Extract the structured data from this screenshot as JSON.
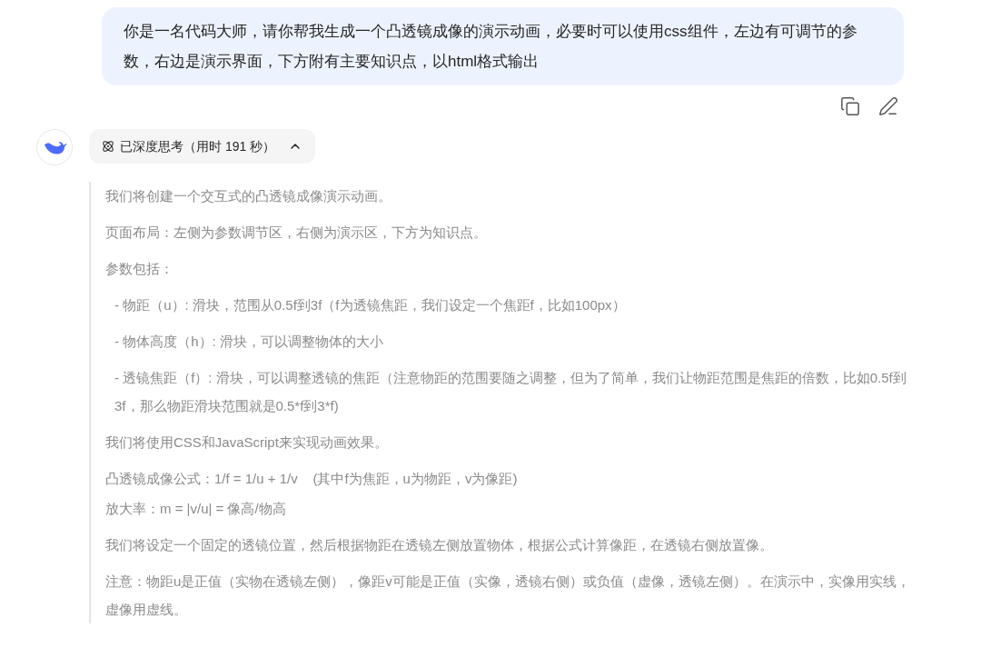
{
  "user_message": {
    "text": "你是一名代码大师，请你帮我生成一个凸透镜成像的演示动画，必要时可以使用css组件，左边有可调节的参数，右边是演示界面，下方附有主要知识点，以html格式输出"
  },
  "thinking": {
    "label": "已深度思考（用时 191 秒）",
    "expanded": true,
    "paragraphs": [
      {
        "kind": "plain",
        "text": "我们将创建一个交互式的凸透镜成像演示动画。"
      },
      {
        "kind": "plain",
        "text": "页面布局：左侧为参数调节区，右侧为演示区，下方为知识点。"
      },
      {
        "kind": "plain",
        "text": "参数包括："
      },
      {
        "kind": "item",
        "text": "- 物距（u）: 滑块，范围从0.5f到3f（f为透镜焦距，我们设定一个焦距f，比如100px）"
      },
      {
        "kind": "item",
        "text": "- 物体高度（h）: 滑块，可以调整物体的大小"
      },
      {
        "kind": "item",
        "text": "- 透镜焦距（f）: 滑块，可以调整透镜的焦距（注意物距的范围要随之调整，但为了简单，我们让物距范围是焦距的倍数，比如0.5f到3f，那么物距滑块范围就是0.5*f到3*f)"
      },
      {
        "kind": "plain",
        "text": "我们将使用CSS和JavaScript来实现动画效果。"
      },
      {
        "kind": "tight",
        "text": "凸透镜成像公式：1/f = 1/u + 1/v    (其中f为焦距，u为物距，v为像距)"
      },
      {
        "kind": "plain",
        "text": "放大率：m = |v/u| = 像高/物高"
      },
      {
        "kind": "plain",
        "text": "我们将设定一个固定的透镜位置，然后根据物距在透镜左侧放置物体，根据公式计算像距，在透镜右侧放置像。"
      },
      {
        "kind": "plain",
        "text": "注意：物距u是正值（实物在透镜左侧），像距v可能是正值（实像，透镜右侧）或负值（虚像，透镜左侧）。在演示中，实像用实线，虚像用虚线。"
      }
    ]
  }
}
